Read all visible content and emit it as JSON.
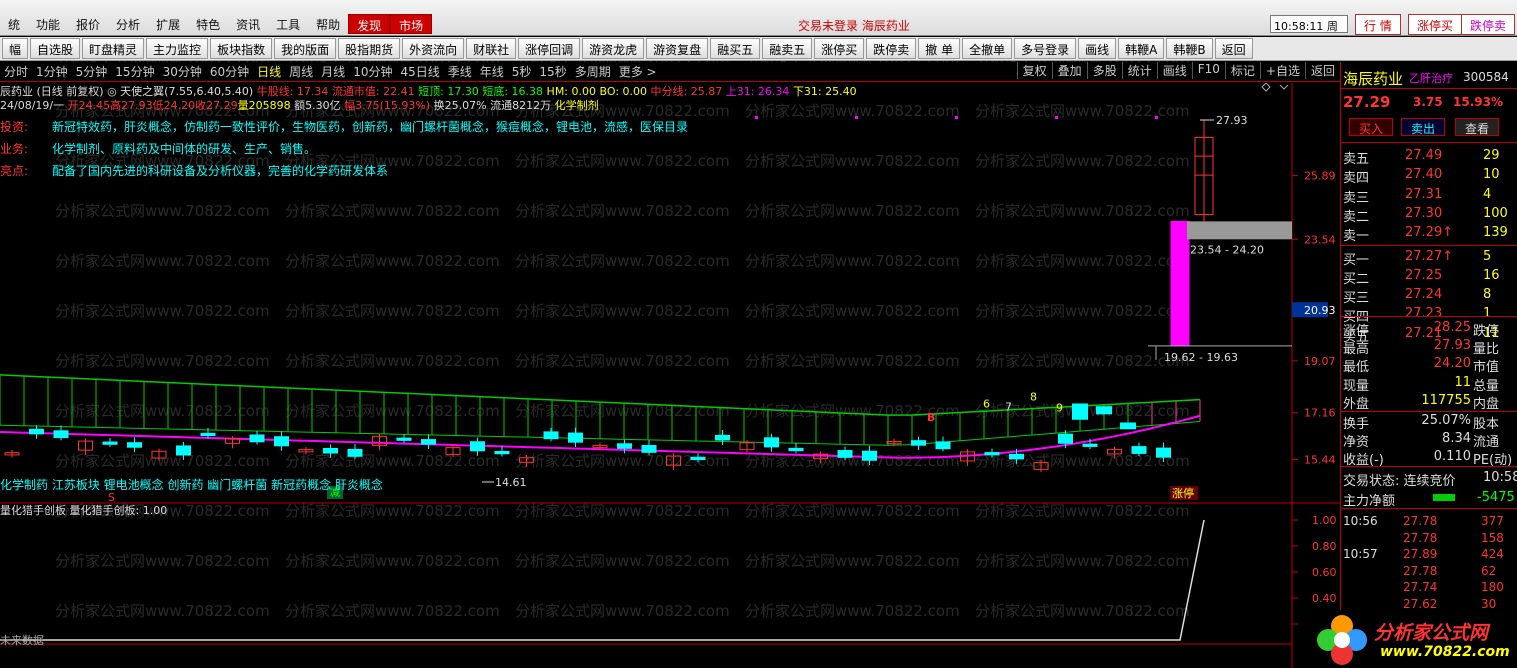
{
  "menu": [
    "统",
    "功能",
    "报价",
    "分析",
    "扩展",
    "特色",
    "资讯",
    "工具",
    "帮助",
    "发现",
    "市场"
  ],
  "status_text": "交易未登录  海辰药业",
  "clock": "10:58:11 周一",
  "top_buttons": [
    "行 情",
    "涨停买",
    "跌停卖"
  ],
  "toolbar": [
    "幅",
    "自选股",
    "盯盘精灵",
    "主力监控",
    "板块指数",
    "我的版面",
    "股指期货",
    "外资流向",
    "财联社",
    "涨停回调",
    "游资龙虎",
    "游资复盘",
    "融买五",
    "融卖五",
    "涨停买",
    "跌停卖",
    "撤 单",
    "全撤单",
    "多号登录",
    "画线",
    "韩鞭A",
    "韩鞭B",
    "返回"
  ],
  "periods": [
    "分时",
    "1分钟",
    "5分钟",
    "15分钟",
    "30分钟",
    "60分钟",
    "日线",
    "周线",
    "月线",
    "10分钟",
    "45日线",
    "季线",
    "年线",
    "5秒",
    "15秒",
    "多周期",
    "更多 >"
  ],
  "period_active": "日线",
  "right_tools": [
    "复权",
    "叠加",
    "多股",
    "统计",
    "画线",
    "F10",
    "标记",
    "+自选",
    "返回"
  ],
  "info_line1": {
    "name": "辰药业 (日线 前复权)",
    "indicator": "◎ 天使之翼(7.55,6.40,5.40)",
    "a": "牛股线: 17.34",
    "b": "流通市值: 22.41",
    "c": "短顶: 17.30",
    "d": "短底: 16.38",
    "e": "HM: 0.00  BO: 0.00",
    "f": "中分线: 25.87",
    "g": "上31: 26.34",
    "h": "下31: 25.40"
  },
  "info_line2": {
    "date": "24/08/19/一",
    "open": "开24.45",
    "high": "高27.93",
    "low": "低24.20",
    "close": "收27.29",
    "vol": "量205898",
    "amt": "额5.30亿",
    "chg": "幅3.75(15.93%)",
    "turn": "换25.07%",
    "flow": "流通8212万",
    "tag": "化学制剂"
  },
  "fundamentals": [
    {
      "label": "投资:",
      "text": "新冠特效药，肝炎概念，仿制药一致性评价，生物医药，创新药，幽门螺杆菌概念，猴痘概念，锂电池，流感，医保目录"
    },
    {
      "label": "业务:",
      "text": "化学制剂、原料药及中间体的研发、生产、销售。"
    },
    {
      "label": "亮点:",
      "text": "配备了国内先进的科研设备及分析仪器，完善的化学药研发体系"
    }
  ],
  "concepts": "化学制药 江苏板块 锂电池概念 创新药 幽门螺杆菌 新冠药概念 肝炎概念",
  "indicator_title": "量化猎手创板  量化猎手创板: 1.00",
  "future_text": "未来数据",
  "price_axis": [
    "25.89",
    "23.54",
    "20.93",
    "19.07",
    "17.16",
    "15.44"
  ],
  "ind_axis": [
    "1.00",
    "0.80",
    "0.60",
    "0.40",
    "0.20"
  ],
  "chart_labels": {
    "high": "27.93",
    "gap1": "23.54 - 24.20",
    "gap2": "19.62 - 19.63",
    "low": "14.61",
    "zt": "涨停",
    "s": "S",
    "b": "B",
    "n6": "6",
    "n7": "7",
    "n8": "8",
    "n9": "9",
    "jian": "减"
  },
  "stock": {
    "name": "海辰药业",
    "tag": "乙肝治疗",
    "code": "300584",
    "price": "27.29",
    "chg": "3.75",
    "pct": "15.93%"
  },
  "trade_buttons": [
    "买入",
    "卖出",
    "查看"
  ],
  "order_book": [
    {
      "l": "卖五",
      "p": "27.49",
      "v": "29"
    },
    {
      "l": "卖四",
      "p": "27.40",
      "v": "10"
    },
    {
      "l": "卖三",
      "p": "27.31",
      "v": "4"
    },
    {
      "l": "卖二",
      "p": "27.30",
      "v": "100"
    },
    {
      "l": "卖一",
      "p": "27.29↑",
      "v": "139"
    },
    {
      "l": "买一",
      "p": "27.27↑",
      "v": "5"
    },
    {
      "l": "买二",
      "p": "27.25",
      "v": "16"
    },
    {
      "l": "买三",
      "p": "27.24",
      "v": "8"
    },
    {
      "l": "买四",
      "p": "27.23",
      "v": "1"
    },
    {
      "l": "买五",
      "p": "27.21",
      "v": "11"
    }
  ],
  "stats": [
    {
      "l": "涨停",
      "v": "28.25",
      "l2": "跌停"
    },
    {
      "l": "最高",
      "v": "27.93",
      "l2": "量比"
    },
    {
      "l": "最低",
      "v": "24.20",
      "l2": "市值"
    },
    {
      "l": "现量",
      "v": "11",
      "l2": "总量"
    },
    {
      "l": "外盘",
      "v": "117755",
      "l2": "内盘"
    },
    {
      "l": "换手",
      "v": "25.07%",
      "l2": "股本"
    },
    {
      "l": "净资",
      "v": "8.34",
      "l2": "流通"
    },
    {
      "l": "收益(-)",
      "v": "0.110",
      "l2": "PE(动)"
    }
  ],
  "trade_state": "交易状态: 连续竞价",
  "trade_time": "10:58",
  "main_net": "主力净额",
  "main_net_val": "-5475",
  "ticks": [
    {
      "t": "10:56",
      "p": "27.78",
      "v": "377"
    },
    {
      "t": "",
      "p": "27.78",
      "v": "158"
    },
    {
      "t": "10:57",
      "p": "27.89",
      "v": "424"
    },
    {
      "t": "",
      "p": "27.78",
      "v": "62"
    },
    {
      "t": "",
      "p": "27.74",
      "v": "180"
    },
    {
      "t": "",
      "p": "27.62",
      "v": "30"
    }
  ],
  "logo_text": "分析家公式网",
  "logo_url": "www.70822.com",
  "watermark": "分析家公式网www.70822.com",
  "colors": {
    "up": "#ff3333",
    "down": "#00ffff",
    "magenta": "#ff00ff",
    "yellow": "#ffff00",
    "green_ribbon": "#00cc00"
  }
}
